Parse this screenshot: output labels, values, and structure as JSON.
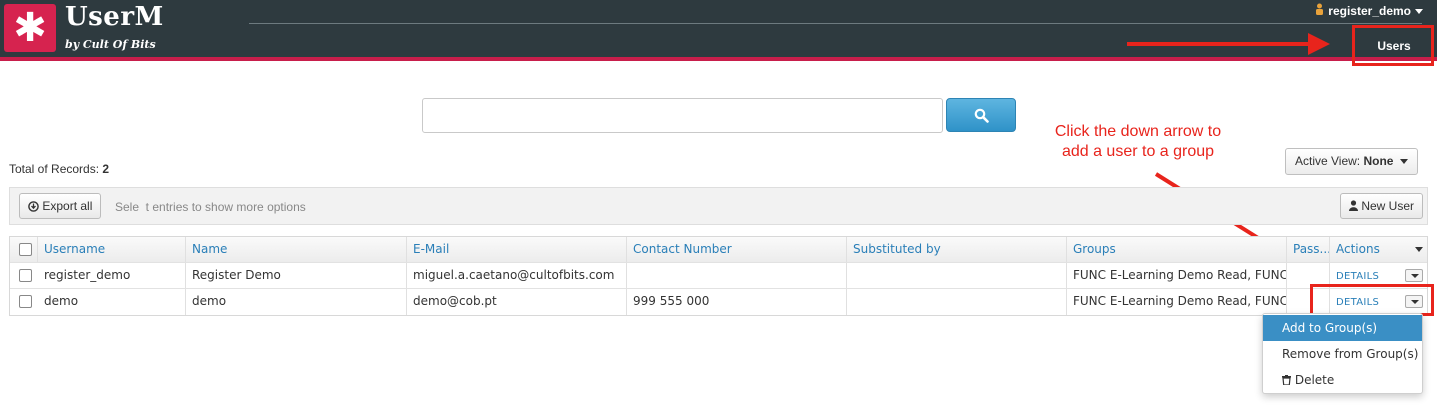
{
  "header": {
    "logo_symbol": "✱",
    "app_title": "UserM",
    "app_subtitle": "by Cult Of Bits",
    "user_name": "register_demo",
    "nav_users": "Users"
  },
  "annotation": {
    "line1": "Click the down arrow to",
    "line2": "add a user to a group"
  },
  "search": {
    "value": "",
    "placeholder": ""
  },
  "total": {
    "label": "Total of Records:",
    "value": "2"
  },
  "active_view": {
    "label": "Active View:",
    "value": "None"
  },
  "toolbar": {
    "export_label": "Export all",
    "hint": "Sele  t entries to show more options",
    "new_user_label": "New User"
  },
  "table": {
    "headers": [
      "Username",
      "Name",
      "E-Mail",
      "Contact Number",
      "Substituted by",
      "Groups",
      "Pass...",
      "Actions"
    ],
    "rows": [
      {
        "username": "register_demo",
        "name": "Register Demo",
        "email": "miguel.a.caetano@cultofbits.com",
        "contact": "",
        "substituted": "",
        "groups": "FUNC E-Learning Demo Read, FUNC ...",
        "pass": "",
        "action": "DETAILS"
      },
      {
        "username": "demo",
        "name": "demo",
        "email": "demo@cob.pt",
        "contact": "999 555 000",
        "substituted": "",
        "groups": "FUNC E-Learning Demo Read, FUNC ...",
        "pass": "",
        "action": "DETAILS"
      }
    ]
  },
  "menu": {
    "items": [
      "Add to Group(s)",
      "Remove from Group(s)",
      "Delete"
    ]
  },
  "colors": {
    "header_bg": "#2e3a3f",
    "brand_red": "#c81e4b",
    "accent_blue": "#2a7fb8",
    "annotation_red": "#e8241c"
  }
}
